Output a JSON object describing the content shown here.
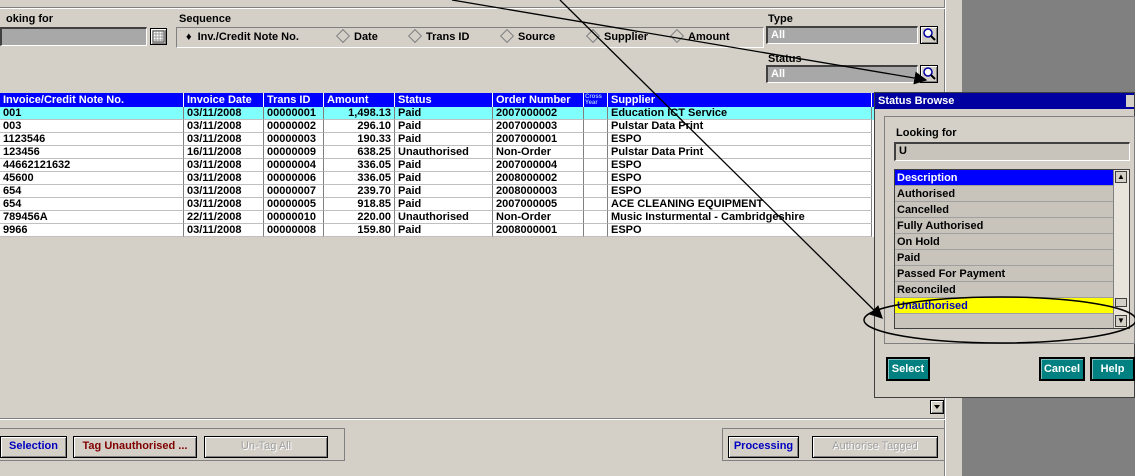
{
  "filters": {
    "looking_for_label": "oking for",
    "looking_for_value": "",
    "sequence_label": "Sequence",
    "sequence_options": [
      "Inv./Credit Note No.",
      "Date",
      "Trans ID",
      "Source",
      "Supplier",
      "Amount"
    ],
    "sequence_selected": "Inv./Credit Note No.",
    "type_label": "Type",
    "type_value": "All",
    "status_label": "Status",
    "status_value": "All"
  },
  "grid": {
    "headers": [
      "Invoice/Credit Note No.",
      "Invoice Date",
      "Trans ID",
      "Amount",
      "Status",
      "Order Number",
      "Cross Year",
      "Supplier"
    ],
    "rows": [
      [
        "001",
        "03/11/2008",
        "00000001",
        "1,498.13",
        "Paid",
        "2007000002",
        "",
        "Education ICT Service"
      ],
      [
        "003",
        "03/11/2008",
        "00000002",
        "296.10",
        "Paid",
        "2007000003",
        "",
        "Pulstar Data Print"
      ],
      [
        "1123546",
        "03/11/2008",
        "00000003",
        "190.33",
        "Paid",
        "2007000001",
        "",
        "ESPO"
      ],
      [
        "123456",
        "16/11/2008",
        "00000009",
        "638.25",
        "Unauthorised",
        "Non-Order",
        "",
        "Pulstar Data Print"
      ],
      [
        "44662121632",
        "03/11/2008",
        "00000004",
        "336.05",
        "Paid",
        "2007000004",
        "",
        "ESPO"
      ],
      [
        "45600",
        "03/11/2008",
        "00000006",
        "336.05",
        "Paid",
        "2008000002",
        "",
        "ESPO"
      ],
      [
        "654",
        "03/11/2008",
        "00000007",
        "239.70",
        "Paid",
        "2008000003",
        "",
        "ESPO"
      ],
      [
        "654",
        "03/11/2008",
        "00000005",
        "918.85",
        "Paid",
        "2007000005",
        "",
        "ACE CLEANING EQUIPMENT"
      ],
      [
        "789456A",
        "22/11/2008",
        "00000010",
        "220.00",
        "Unauthorised",
        "Non-Order",
        "",
        "Music Insturmental - Cambridgeshire"
      ],
      [
        "9966",
        "03/11/2008",
        "00000008",
        "159.80",
        "Paid",
        "2008000001",
        "",
        "ESPO"
      ]
    ],
    "selected_row": 0
  },
  "buttons": {
    "selection": "Selection",
    "tag_unauthorised": "Tag Unauthorised ...",
    "untag_all": "Un-Tag All",
    "processing": "Processing",
    "authorise_tagged": "Authorise Tagged"
  },
  "status_browse": {
    "title": "Status Browse",
    "looking_for_label": "Looking for",
    "looking_for_value": "U",
    "list_header": "Description",
    "items": [
      "Authorised",
      "Cancelled",
      "Fully Authorised",
      "On Hold",
      "Paid",
      "Passed For Payment",
      "Reconciled",
      "Unauthorised"
    ],
    "highlighted_item": "Unauthorised",
    "select_label": "Select",
    "cancel_label": "Cancel",
    "help_label": "Help"
  },
  "colors": {
    "header_blue": "#0000ff",
    "selected_row": "#80ffff",
    "highlight_yellow": "#ffff00",
    "teal_button": "#008080"
  }
}
